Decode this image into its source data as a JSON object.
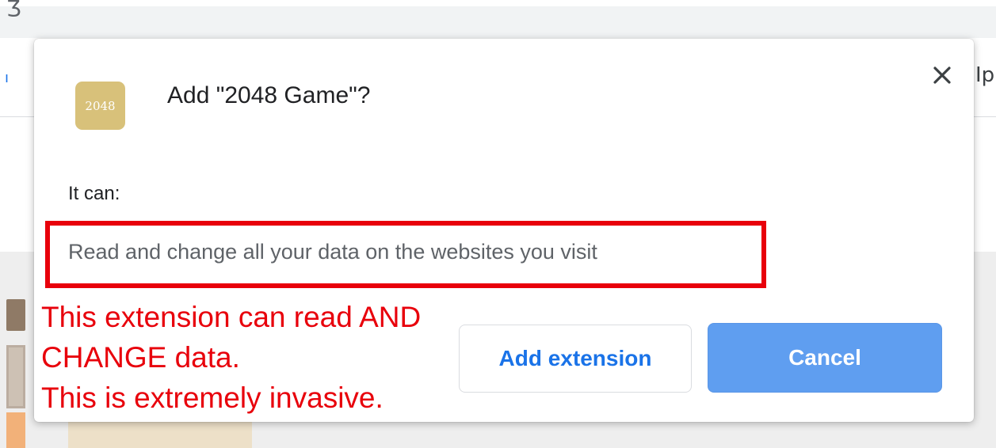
{
  "background": {
    "corner_glyph": "Ʒ",
    "tab_glyph": "ı",
    "right_text": "Ip"
  },
  "dialog": {
    "icon_text": "2048",
    "title": "Add \"2048 Game\"?",
    "close_label": "✕",
    "it_can_label": "It can:",
    "permission": "Read and change all your data on the websites you visit",
    "add_button_label": "Add extension",
    "cancel_button_label": "Cancel"
  },
  "annotation": {
    "lines": [
      "This extension can read AND",
      "CHANGE data.",
      "This is extremely invasive."
    ],
    "color": "#e8000b"
  },
  "colors": {
    "accent": "#1a73e8",
    "cancel_bg": "#5f9ef0",
    "icon_bg": "#d8c17a"
  },
  "icons": {
    "close": "close-icon",
    "extension": "extension-logo-icon"
  }
}
